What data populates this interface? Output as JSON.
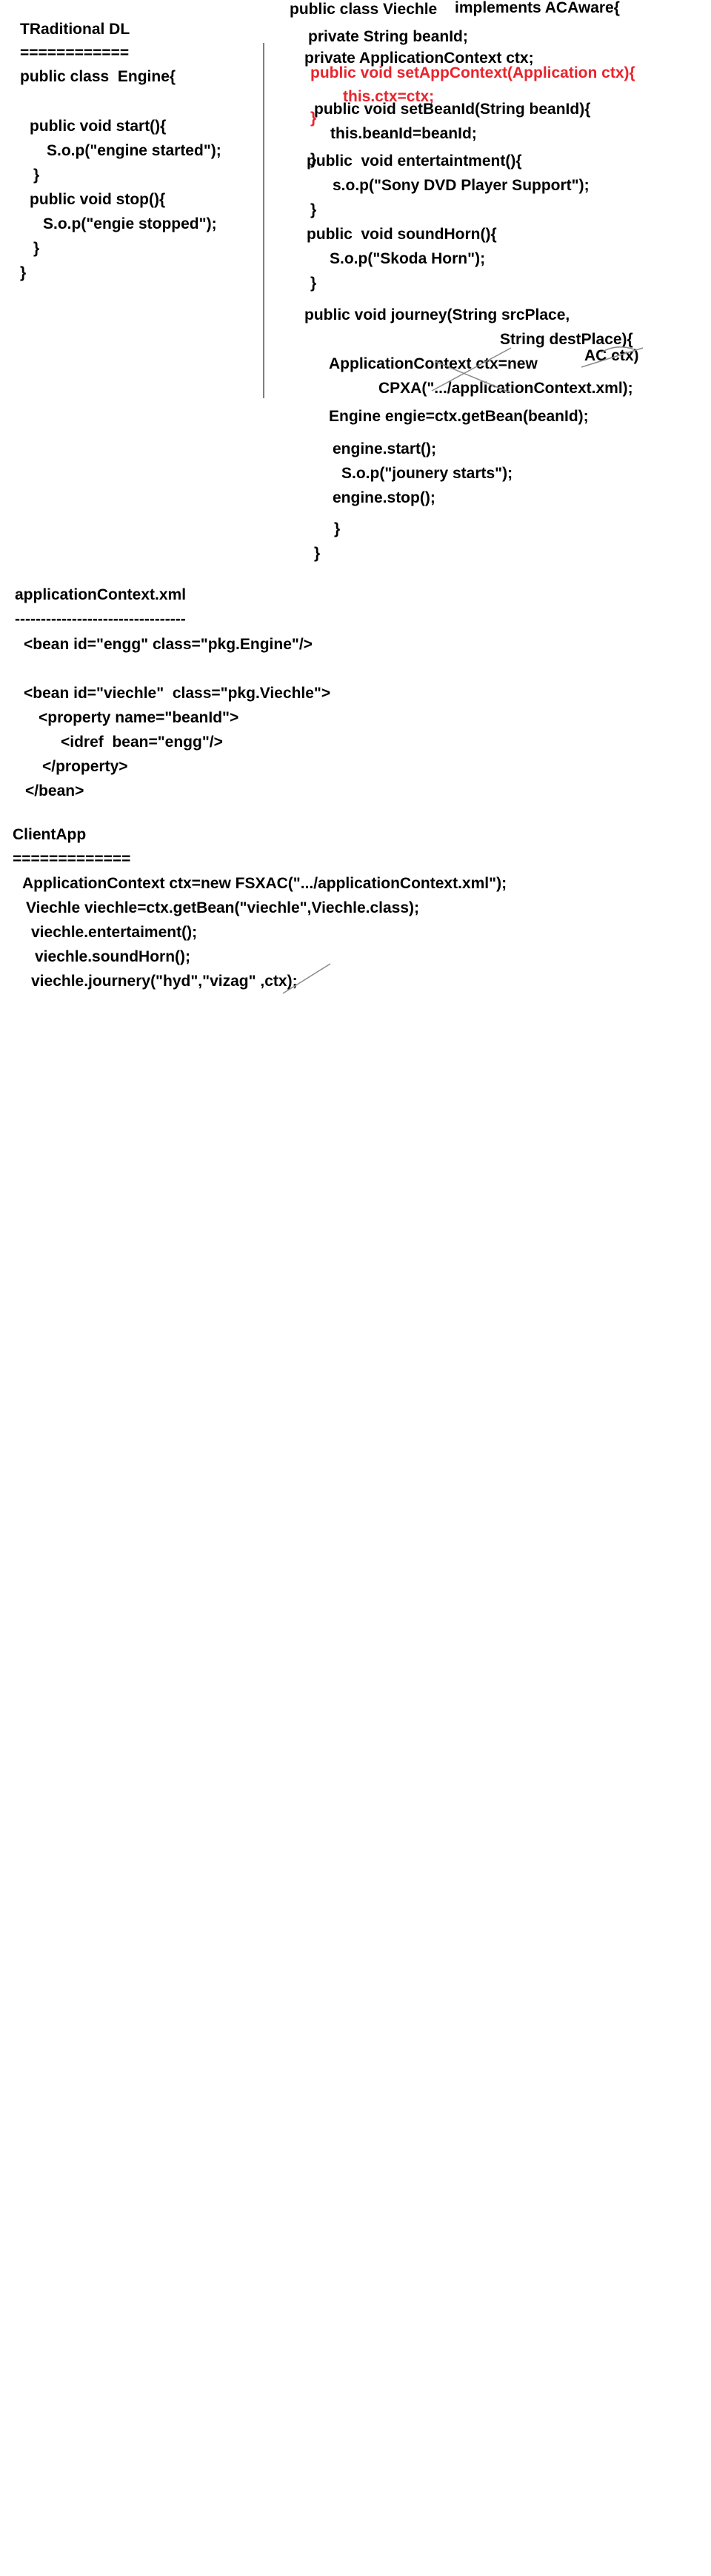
{
  "colors": {
    "text": "#000000",
    "highlight": "#e8242d",
    "divider": "#7f7f7f",
    "strike": "#8a8a8a"
  },
  "traditional": {
    "title": "TRaditional DL",
    "rule": "============",
    "class_decl": "public class  Engine{",
    "start_sig": "public void start(){",
    "start_body": "S.o.p(\"engine started\");",
    "start_close": "}",
    "stop_sig": "public void stop(){",
    "stop_body": "S.o.p(\"engie stopped\");",
    "stop_close": "}",
    "class_close": "}"
  },
  "viechle": {
    "class_decl": "public class Viechle",
    "implements": "implements ACAware{",
    "field_beanid": "private String beanId;",
    "field_ctx": "private ApplicationContext ctx;",
    "set_ctx_sig": "public void setAppContext(Application ctx){",
    "set_ctx_body": "this.ctx=ctx;",
    "set_ctx_close": "}",
    "set_beanid_sig": "public void setBeanId(String beanId){",
    "set_beanid_body": "this.beanId=beanId;",
    "set_beanid_close": "}",
    "ent_sig": "public  void entertaintment(){",
    "ent_body": "s.o.p(\"Sony DVD Player Support\");",
    "ent_close": "}",
    "horn_sig": "public  void soundHorn(){",
    "horn_body": "S.o.p(\"Skoda Horn\");",
    "horn_close": "}",
    "journey_sig": "public void journey(String srcPlace,",
    "journey_sig2": "String destPlace){",
    "ac_ctx_note": "AC ctx)",
    "ctx_decl": "ApplicationContext ctx=new",
    "ctx_new": "CPXA(\".../applicationContext.xml);",
    "get_bean": "Engine engie=ctx.getBean(beanId);",
    "engine_start": "engine.start();",
    "journey_sop": "S.o.p(\"jounery starts\");",
    "engine_stop": "engine.stop();",
    "method_close": "}",
    "class_close": "}"
  },
  "xml": {
    "title": "applicationContext.xml",
    "rule": "---------------------------------",
    "bean_engine": "<bean id=\"engg\" class=\"pkg.Engine\"/>",
    "bean_viechle": "<bean id=\"viechle\"  class=\"pkg.Viechle\">",
    "property_open": "<property name=\"beanId\">",
    "idref": "<idref  bean=\"engg\"/>",
    "property_close": "</property>",
    "bean_close": "</bean>"
  },
  "client": {
    "title": "ClientApp",
    "rule": "=============",
    "ctx_line": "ApplicationContext ctx=new FSXAC(\".../applicationContext.xml\");",
    "get_bean": "Viechle viechle=ctx.getBean(\"viechle\",Viechle.class);",
    "ent_call": "viechle.entertaiment();",
    "horn_call": "viechle.soundHorn();",
    "journey_call": "viechle.journery(\"hyd\",\"vizag\" ,ctx);"
  }
}
